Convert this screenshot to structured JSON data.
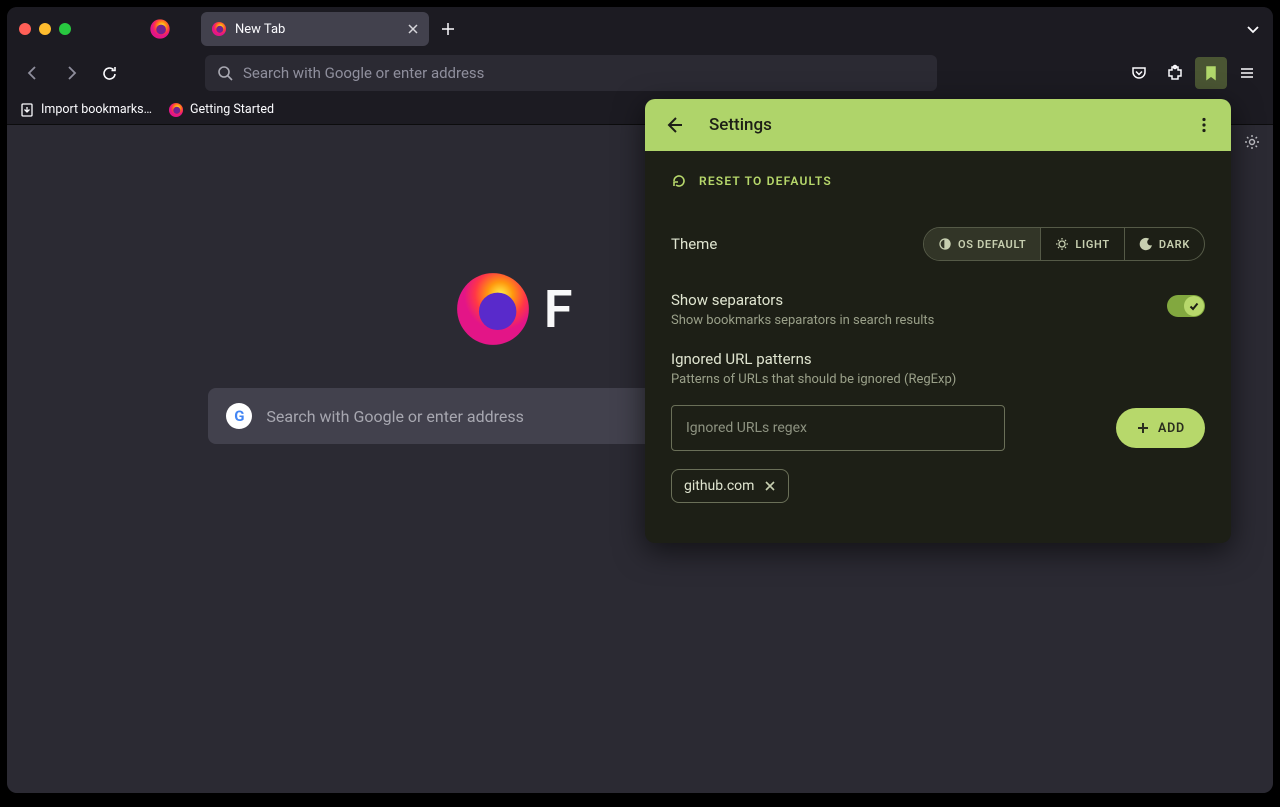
{
  "tab": {
    "title": "New Tab"
  },
  "urlbar": {
    "placeholder": "Search with Google or enter address"
  },
  "bookmarks": [
    {
      "label": "Import bookmarks…"
    },
    {
      "label": "Getting Started"
    }
  ],
  "newtab": {
    "wordmark": "F",
    "search_placeholder": "Search with Google or enter address"
  },
  "panel": {
    "title": "Settings",
    "reset": "RESET TO DEFAULTS",
    "theme": {
      "label": "Theme",
      "options": [
        "OS DEFAULT",
        "LIGHT",
        "DARK"
      ],
      "selected": 0
    },
    "separators": {
      "title": "Show separators",
      "subtitle": "Show bookmarks separators in search results",
      "enabled": true
    },
    "ignored": {
      "title": "Ignored URL patterns",
      "subtitle": "Patterns of URLs that should be ignored (RegExp)",
      "placeholder": "Ignored URLs regex",
      "add_label": "ADD",
      "chips": [
        "github.com"
      ]
    }
  }
}
